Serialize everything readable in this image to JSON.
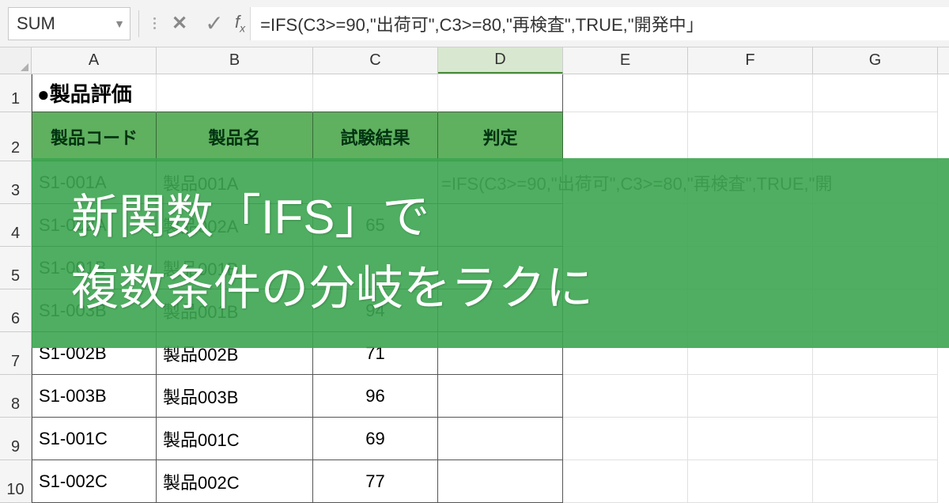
{
  "name_box": "SUM",
  "formula": "=IFS(C3>=90,\"出荷可\",C3>=80,\"再検査\",TRUE,\"開発中」",
  "columns": [
    "A",
    "B",
    "C",
    "D",
    "E",
    "F",
    "G"
  ],
  "title": "●製品評価",
  "headers": {
    "code": "製品コード",
    "name": "製品名",
    "result": "試験結果",
    "judge": "判定"
  },
  "formula_cell": "=IFS(C3>=90,\"出荷可\",C3>=80,\"再検査\",TRUE,\"開",
  "rows": [
    {
      "n": "3",
      "code": "S1-001A",
      "name": "製品001A",
      "result": "",
      "judge_formula": true
    },
    {
      "n": "4",
      "code": "S1-002A",
      "name": "製品002A",
      "result": "65"
    },
    {
      "n": "5",
      "code": "S1-001B",
      "name": "製品001B",
      "result": ""
    },
    {
      "n": "6",
      "code": "S1-003B",
      "name": "製品001B",
      "result": "94"
    },
    {
      "n": "7",
      "code": "S1-002B",
      "name": "製品002B",
      "result": "71"
    },
    {
      "n": "8",
      "code": "S1-003B",
      "name": "製品003B",
      "result": "96"
    },
    {
      "n": "9",
      "code": "S1-001C",
      "name": "製品001C",
      "result": "69"
    },
    {
      "n": "10",
      "code": "S1-002C",
      "name": "製品002C",
      "result": "77"
    }
  ],
  "overlay": {
    "line1": "新関数「IFS」で",
    "line2": "複数条件の分岐をラクに"
  }
}
